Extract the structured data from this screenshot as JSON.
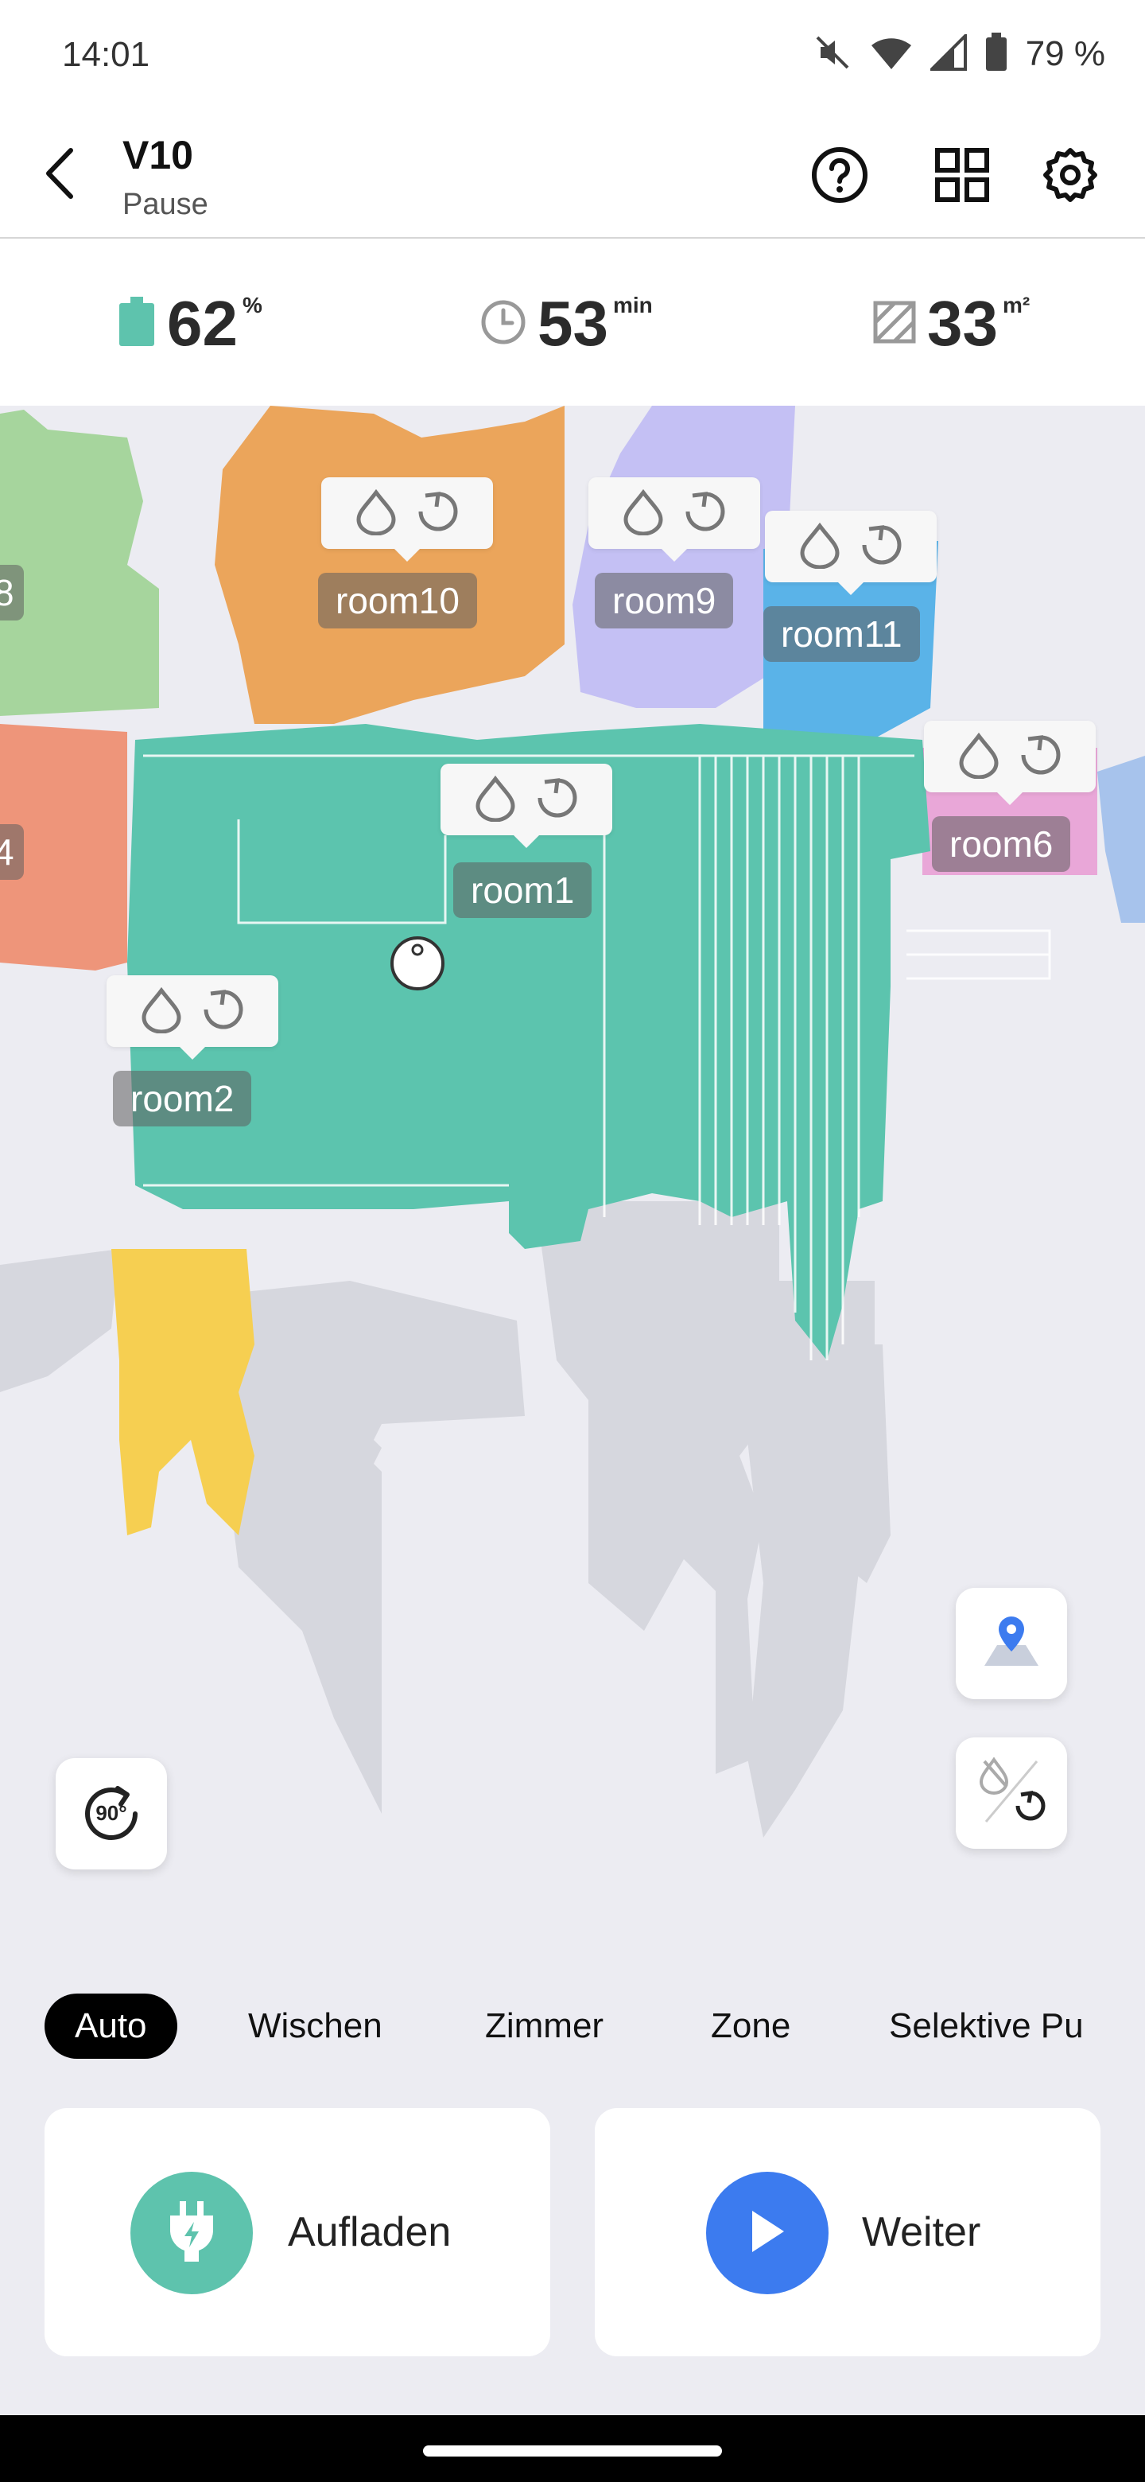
{
  "status_bar": {
    "time": "14:01",
    "battery_text": "79 %",
    "icons": [
      "mute-icon",
      "wifi-icon",
      "cellular-icon",
      "battery-icon"
    ]
  },
  "header": {
    "title": "V10",
    "subtitle": "Pause",
    "icons": [
      "back-icon",
      "help-icon",
      "grid-icon",
      "settings-icon"
    ]
  },
  "stats": {
    "battery": {
      "value": "62",
      "unit": "%"
    },
    "time": {
      "value": "53",
      "unit": "min"
    },
    "area": {
      "value": "33",
      "unit": "m²"
    }
  },
  "map": {
    "rooms": [
      {
        "name": "room10",
        "color": "#eba55b"
      },
      {
        "name": "room9",
        "color": "#c4c0f4"
      },
      {
        "name": "room11",
        "color": "#5ab3e8"
      },
      {
        "name": "room1",
        "color": "#5cc4ae"
      },
      {
        "name": "room6",
        "color": "#e9a7d8"
      },
      {
        "name": "room2",
        "color": "#f6cf51"
      }
    ],
    "partial_labels": {
      "left_top": "8",
      "left_mid": "4"
    },
    "rotate_label": "90°"
  },
  "modes": {
    "tabs": [
      "Auto",
      "Wischen",
      "Zimmer",
      "Zone",
      "Selektive Pu"
    ],
    "active": "Auto"
  },
  "actions": {
    "charge": {
      "label": "Aufladen",
      "color": "#5ec3ad"
    },
    "resume": {
      "label": "Weiter",
      "color": "#3c7bef"
    }
  }
}
